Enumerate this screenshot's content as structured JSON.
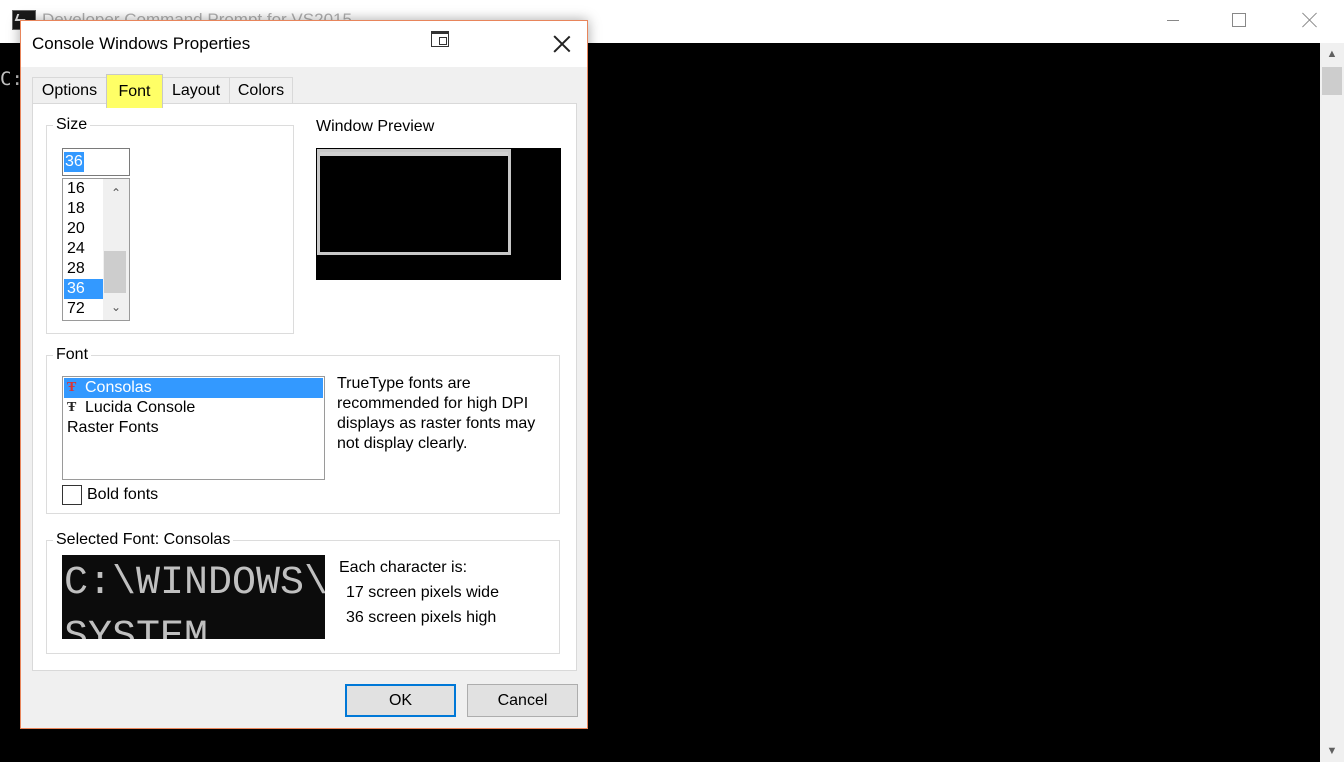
{
  "background_window": {
    "title": "Developer Command Prompt for VS2015",
    "console_text": "C:",
    "controls": [
      "minimize-icon",
      "maximize-icon",
      "close-icon"
    ]
  },
  "dialog": {
    "title": "Console Windows Properties",
    "tabs": [
      {
        "label": "Options",
        "active": false
      },
      {
        "label": "Font",
        "active": true
      },
      {
        "label": "Layout",
        "active": false
      },
      {
        "label": "Colors",
        "active": false
      }
    ],
    "size": {
      "legend": "Size",
      "input_value": "36",
      "options": [
        "16",
        "18",
        "20",
        "24",
        "28",
        "36",
        "72"
      ],
      "selected": "36"
    },
    "window_preview": {
      "label": "Window Preview"
    },
    "font": {
      "legend": "Font",
      "options": [
        {
          "label": "Consolas",
          "icon": "truetype-icon",
          "selected": true
        },
        {
          "label": "Lucida Console",
          "icon": "truetype-icon",
          "selected": false
        },
        {
          "label": "Raster Fonts",
          "icon": "",
          "selected": false
        }
      ],
      "note": "TrueType fonts are recommended for high DPI displays as raster fonts may not display clearly.",
      "bold_label": "Bold fonts",
      "bold_checked": false
    },
    "selected_font": {
      "legend": "Selected Font: Consolas",
      "sample_line1": "C:\\WINDOWS\\",
      "sample_line2": "SYSTEM",
      "char_heading": "Each character is:",
      "width_text": "17 screen pixels wide",
      "height_text": "36 screen pixels high"
    },
    "buttons": {
      "ok": "OK",
      "cancel": "Cancel"
    }
  },
  "colors": {
    "selection": "#3399ff",
    "tab_highlight": "#ffff66",
    "dialog_border": "#e8855b",
    "ok_focus": "#0078d7"
  }
}
